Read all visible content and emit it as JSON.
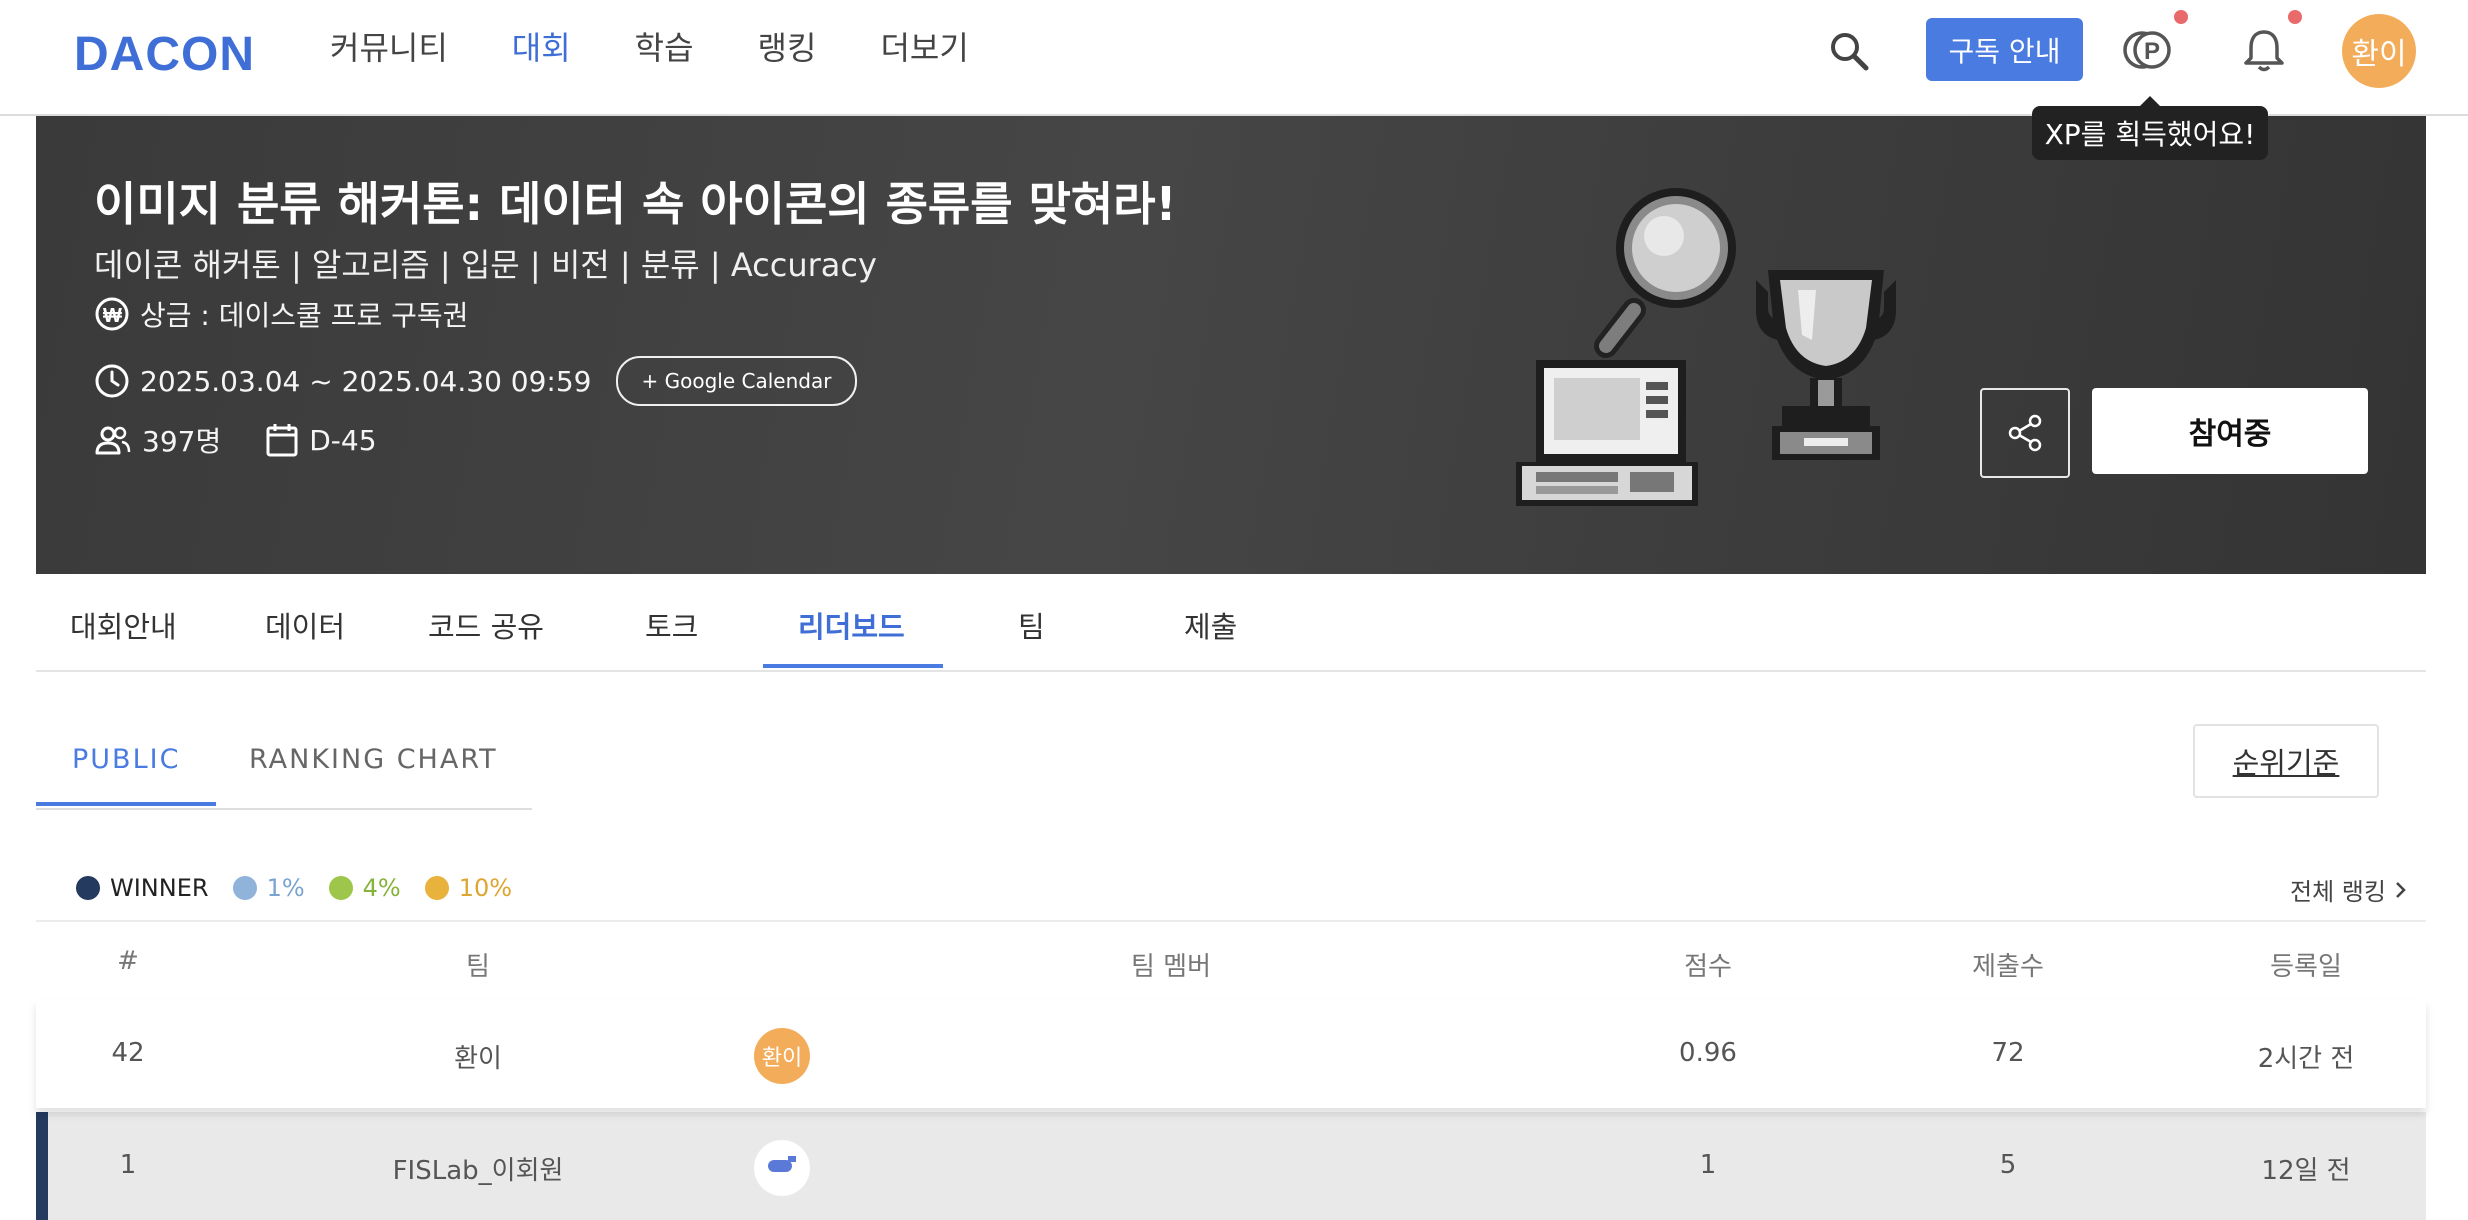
{
  "nav": {
    "logo": "DACON",
    "items": [
      "커뮤니티",
      "대회",
      "학습",
      "랭킹",
      "더보기"
    ],
    "subscribe_label": "구독 안내",
    "user_initials": "환이",
    "tooltip": "XP를 획득했어요!"
  },
  "banner": {
    "title": "이미지 분류 해커톤: 데이터 속 아이콘의 종류를 맞혀라!",
    "tags": "데이콘 해커톤 | 알고리즘 | 입문 | 비전 | 분류 | Accuracy",
    "prize": "상금 : 데이스쿨 프로 구독권",
    "period": "2025.03.04 ~ 2025.04.30 09:59",
    "calendar_button": "+ Google Calendar",
    "participants": "397명",
    "dday": "D-45",
    "join_button": "참여중"
  },
  "tabs": [
    "대회안내",
    "데이터",
    "코드 공유",
    "토크",
    "리더보드",
    "팀",
    "제출"
  ],
  "subtabs": [
    "PUBLIC",
    "RANKING CHART"
  ],
  "criteria_button": "순위기준",
  "legend": [
    {
      "label": "WINNER",
      "color": "#243a5e"
    },
    {
      "label": "1%",
      "color": "#8fb3d9"
    },
    {
      "label": "4%",
      "color": "#9dc64a"
    },
    {
      "label": "10%",
      "color": "#e8b23c"
    }
  ],
  "full_ranking": "전체 랭킹",
  "table": {
    "headers": [
      "#",
      "팀",
      "팀 멤버",
      "점수",
      "제출수",
      "등록일"
    ],
    "rows": [
      {
        "rank": "42",
        "team": "환이",
        "member": "환이",
        "score": "0.96",
        "submissions": "72",
        "date": "2시간 전"
      },
      {
        "rank": "1",
        "team": "FISLab_이회원",
        "member": "",
        "score": "1",
        "submissions": "5",
        "date": "12일 전"
      }
    ]
  }
}
